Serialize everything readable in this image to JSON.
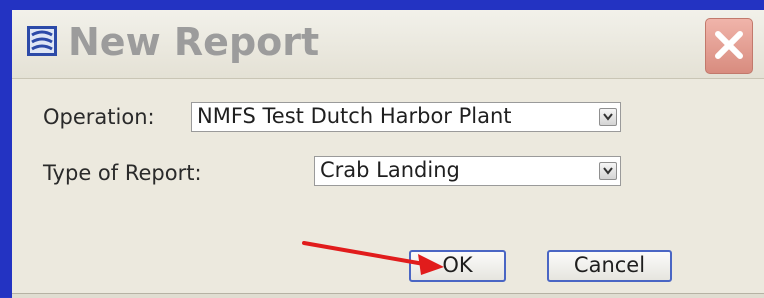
{
  "window": {
    "title": "New Report"
  },
  "form": {
    "operation_label": "Operation:",
    "operation_value": "NMFS Test Dutch Harbor Plant",
    "report_type_label": "Type of Report:",
    "report_type_value": "Crab Landing"
  },
  "buttons": {
    "ok_label": "OK",
    "cancel_label": "Cancel"
  },
  "icons": {
    "app": "report-app-icon",
    "close": "close-icon",
    "dropdown": "chevron-down-icon",
    "annotation": "red-arrow-icon"
  },
  "colors": {
    "frame": "#2333c2",
    "close_button": "#e3a093",
    "annotation_arrow": "#e11c1c"
  }
}
